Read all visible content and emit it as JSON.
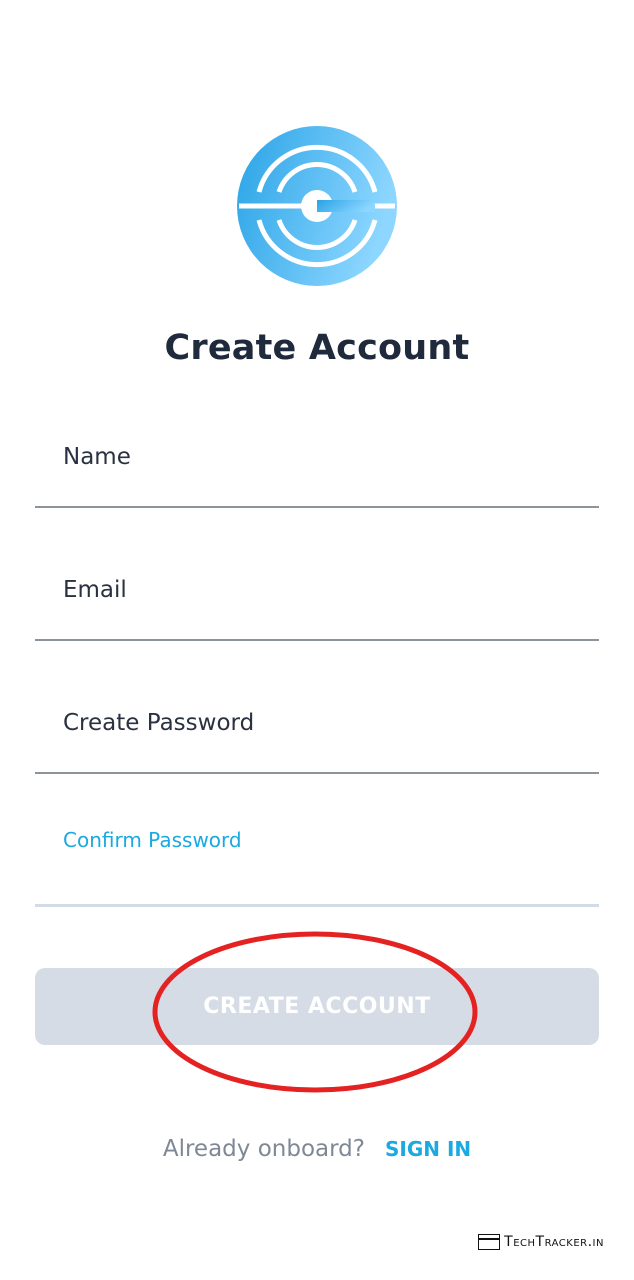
{
  "header": {
    "title": "Create Account"
  },
  "form": {
    "name_label": "Name",
    "email_label": "Email",
    "password_label": "Create Password",
    "confirm_label": "Confirm Password"
  },
  "actions": {
    "create_label": "CREATE ACCOUNT"
  },
  "footer": {
    "question": "Already onboard?",
    "signin_label": "SIGN IN"
  },
  "watermark": {
    "text": "TechTracker.in"
  },
  "colors": {
    "accent": "#1ba9e1",
    "logo_gradient_start": "#29a3e6",
    "logo_gradient_end": "#8cd6ff",
    "button_disabled_bg": "#d5dce5",
    "annotation_red": "#e52222"
  },
  "icons": {
    "logo": "app-logo-icon"
  }
}
